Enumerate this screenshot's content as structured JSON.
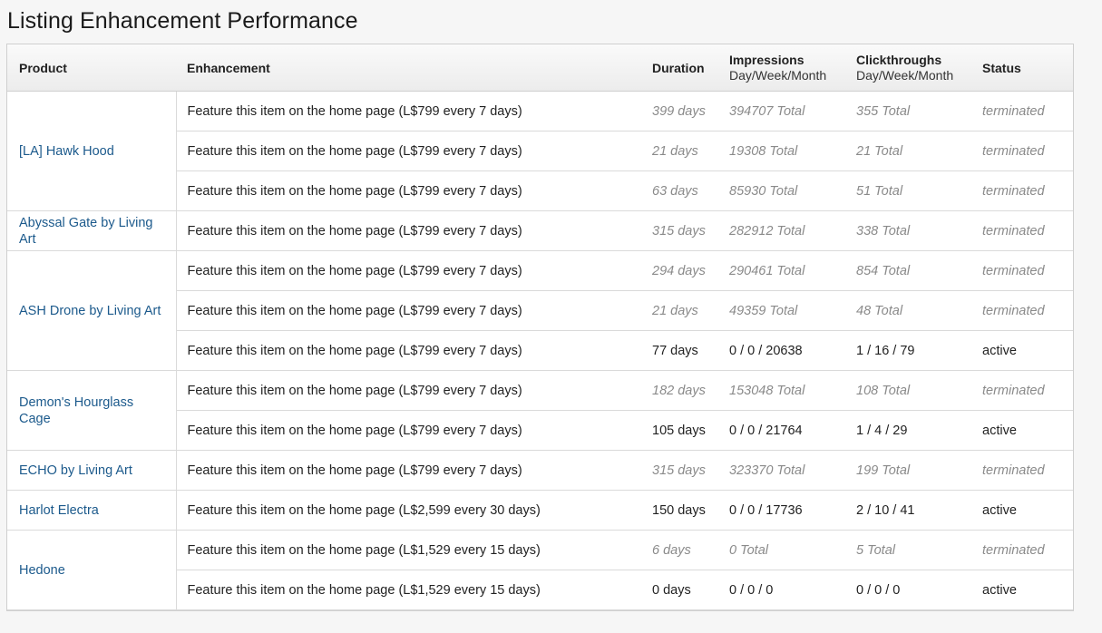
{
  "page": {
    "title": "Listing Enhancement Performance"
  },
  "table": {
    "headers": {
      "product": "Product",
      "enhancement": "Enhancement",
      "duration": "Duration",
      "impressions": "Impressions",
      "impressions_sub": "Day/Week/Month",
      "clickthroughs": "Clickthroughs",
      "clickthroughs_sub": "Day/Week/Month",
      "status": "Status"
    },
    "products": [
      {
        "name": "[LA] Hawk Hood",
        "rows": [
          {
            "enhancement": "Feature this item on the home page (L$799 every 7 days)",
            "duration": "399 days",
            "impressions": "394707 Total",
            "clickthroughs": "355 Total",
            "status": "terminated"
          },
          {
            "enhancement": "Feature this item on the home page (L$799 every 7 days)",
            "duration": "21 days",
            "impressions": "19308 Total",
            "clickthroughs": "21 Total",
            "status": "terminated"
          },
          {
            "enhancement": "Feature this item on the home page (L$799 every 7 days)",
            "duration": "63 days",
            "impressions": "85930 Total",
            "clickthroughs": "51 Total",
            "status": "terminated"
          }
        ]
      },
      {
        "name": "Abyssal Gate by Living Art",
        "rows": [
          {
            "enhancement": "Feature this item on the home page (L$799 every 7 days)",
            "duration": "315 days",
            "impressions": "282912 Total",
            "clickthroughs": "338 Total",
            "status": "terminated"
          }
        ]
      },
      {
        "name": "ASH Drone by Living Art",
        "rows": [
          {
            "enhancement": "Feature this item on the home page (L$799 every 7 days)",
            "duration": "294 days",
            "impressions": "290461 Total",
            "clickthroughs": "854 Total",
            "status": "terminated"
          },
          {
            "enhancement": "Feature this item on the home page (L$799 every 7 days)",
            "duration": "21 days",
            "impressions": "49359 Total",
            "clickthroughs": "48 Total",
            "status": "terminated"
          },
          {
            "enhancement": "Feature this item on the home page (L$799 every 7 days)",
            "duration": "77 days",
            "impressions": "0 / 0 / 20638",
            "clickthroughs": "1 / 16 / 79",
            "status": "active"
          }
        ]
      },
      {
        "name": "Demon's Hourglass Cage",
        "rows": [
          {
            "enhancement": "Feature this item on the home page (L$799 every 7 days)",
            "duration": "182 days",
            "impressions": "153048 Total",
            "clickthroughs": "108 Total",
            "status": "terminated"
          },
          {
            "enhancement": "Feature this item on the home page (L$799 every 7 days)",
            "duration": "105 days",
            "impressions": "0 / 0 / 21764",
            "clickthroughs": "1 / 4 / 29",
            "status": "active"
          }
        ]
      },
      {
        "name": "ECHO by Living Art",
        "rows": [
          {
            "enhancement": "Feature this item on the home page (L$799 every 7 days)",
            "duration": "315 days",
            "impressions": "323370 Total",
            "clickthroughs": "199 Total",
            "status": "terminated"
          }
        ]
      },
      {
        "name": "Harlot Electra",
        "rows": [
          {
            "enhancement": "Feature this item on the home page (L$2,599 every 30 days)",
            "duration": "150 days",
            "impressions": "0 / 0 / 17736",
            "clickthroughs": "2 / 10 / 41",
            "status": "active"
          }
        ]
      },
      {
        "name": "Hedone",
        "rows": [
          {
            "enhancement": "Feature this item on the home page (L$1,529 every 15 days)",
            "duration": "6 days",
            "impressions": "0 Total",
            "clickthroughs": "5 Total",
            "status": "terminated"
          },
          {
            "enhancement": "Feature this item on the home page (L$1,529 every 15 days)",
            "duration": "0 days",
            "impressions": "0 / 0 / 0",
            "clickthroughs": "0 / 0 / 0",
            "status": "active"
          }
        ]
      }
    ]
  },
  "colors": {
    "link": "#1c5a8c",
    "muted": "#8a8a8a",
    "text": "#222222"
  }
}
